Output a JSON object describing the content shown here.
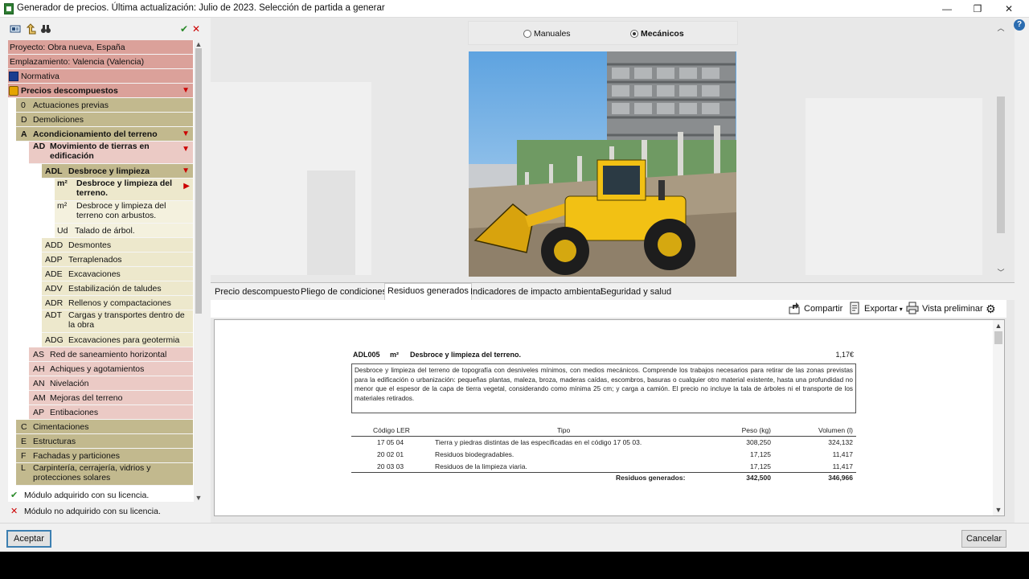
{
  "window": {
    "title": "Generador de precios. Última actualización: Julio de 2023. Selección de partida a generar",
    "minimize": "—",
    "maximize": "❐",
    "close": "✕"
  },
  "left_toolbar": {
    "icons": [
      "card-icon",
      "up-level-icon",
      "binoculars-icon",
      "check-icon",
      "cross-icon"
    ]
  },
  "tree": {
    "project": "Proyecto: Obra nueva, España",
    "location": "Emplazamiento: Valencia (Valencia)",
    "normativa": "Normativa",
    "precios": "Precios descompuestos",
    "items": [
      {
        "code": "0",
        "label": "Actuaciones previas"
      },
      {
        "code": "D",
        "label": "Demoliciones"
      },
      {
        "code": "A",
        "label": "Acondicionamiento del terreno"
      },
      {
        "code": "AD",
        "label": "Movimiento de tierras en edificación"
      },
      {
        "code": "ADL",
        "label": "Desbroce y limpieza"
      },
      {
        "code": "m²",
        "label": "Desbroce y limpieza del terreno."
      },
      {
        "code": "m²",
        "label": "Desbroce y limpieza del terreno con arbustos."
      },
      {
        "code": "Ud",
        "label": "Talado de árbol."
      },
      {
        "code": "ADD",
        "label": "Desmontes"
      },
      {
        "code": "ADP",
        "label": "Terraplenados"
      },
      {
        "code": "ADE",
        "label": "Excavaciones"
      },
      {
        "code": "ADV",
        "label": "Estabilización de taludes"
      },
      {
        "code": "ADR",
        "label": "Rellenos y compactaciones"
      },
      {
        "code": "ADT",
        "label": "Cargas y transportes dentro de la obra"
      },
      {
        "code": "ADG",
        "label": "Excavaciones para geotermia"
      },
      {
        "code": "AS",
        "label": "Red de saneamiento horizontal"
      },
      {
        "code": "AH",
        "label": "Achiques y agotamientos"
      },
      {
        "code": "AN",
        "label": "Nivelación"
      },
      {
        "code": "AM",
        "label": "Mejoras del terreno"
      },
      {
        "code": "AP",
        "label": "Entibaciones"
      },
      {
        "code": "C",
        "label": "Cimentaciones"
      },
      {
        "code": "E",
        "label": "Estructuras"
      },
      {
        "code": "F",
        "label": "Fachadas y particiones"
      },
      {
        "code": "L",
        "label": "Carpintería, cerrajería, vidrios y protecciones solares"
      }
    ]
  },
  "legend": {
    "acquired": "Módulo adquirido con su licencia.",
    "not_acquired": "Módulo no adquirido con su licencia."
  },
  "options": {
    "manuales": "Manuales",
    "mecanicos": "Mecánicos",
    "selected": "Mecánicos"
  },
  "tabs": [
    "Precio descompuesto",
    "Pliego de condiciones",
    "Residuos generados",
    "Indicadores de impacto ambiental",
    "Seguridad y salud"
  ],
  "active_tab": "Residuos generados",
  "doc_toolbar": {
    "share": "Compartir",
    "export": "Exportar",
    "preview": "Vista preliminar"
  },
  "document": {
    "code": "ADL005",
    "unit": "m²",
    "title": "Desbroce y limpieza del terreno.",
    "price": "1,17€",
    "description": "Desbroce y limpieza del terreno de topografía con desniveles mínimos, con medios mecánicos. Comprende los trabajos necesarios para retirar de las zonas previstas para la edificación o urbanización: pequeñas plantas, maleza, broza, maderas caídas, escombros, basuras o cualquier otro material existente, hasta una profundidad no menor que el espesor de la capa de tierra vegetal, considerando como mínima 25 cm; y carga a camión. El precio no incluye la tala de árboles ni el transporte de los materiales retirados.",
    "table": {
      "headers": [
        "Código LER",
        "Tipo",
        "Peso (kg)",
        "Volumen (l)"
      ],
      "rows": [
        [
          "17 05 04",
          "Tierra y piedras distintas de las especificadas en el código 17 05 03.",
          "308,250",
          "324,132"
        ],
        [
          "20 02 01",
          "Residuos biodegradables.",
          "17,125",
          "11,417"
        ],
        [
          "20 03 03",
          "Residuos de la limpieza viaria.",
          "17,125",
          "11,417"
        ]
      ],
      "total_label": "Residuos generados:",
      "total_weight": "342,500",
      "total_volume": "346,966"
    }
  },
  "buttons": {
    "accept": "Aceptar",
    "cancel": "Cancelar"
  },
  "colors": {
    "header_red": "#dba19a",
    "olive": "#c2b98e",
    "cream": "#ede8cc",
    "accent_blue": "#3c7fb1"
  }
}
